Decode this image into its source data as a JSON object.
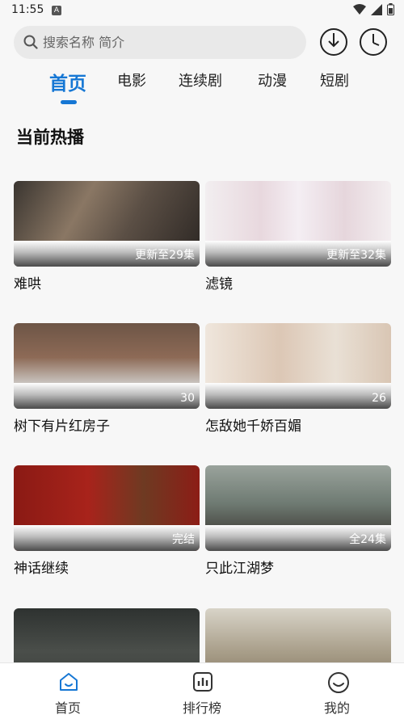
{
  "status_bar": {
    "time": "11:55",
    "notification_letter": "A"
  },
  "search": {
    "placeholder": "搜索名称 简介"
  },
  "tabs": [
    {
      "label": "首页",
      "active": true
    },
    {
      "label": "电影",
      "active": false
    },
    {
      "label": "连续剧",
      "active": false
    },
    {
      "label": "动漫",
      "active": false
    },
    {
      "label": "短剧",
      "active": false
    }
  ],
  "section_title": "当前热播",
  "cards": [
    {
      "title": "难哄",
      "badge": "更新至29集"
    },
    {
      "title": "滤镜",
      "badge": "更新至32集"
    },
    {
      "title": "树下有片红房子",
      "badge": "30"
    },
    {
      "title": "怎敌她千娇百媚",
      "badge": "26"
    },
    {
      "title": "神话继续",
      "badge": "完结"
    },
    {
      "title": "只此江湖梦",
      "badge": "全24集"
    },
    {
      "title": "",
      "badge": ""
    },
    {
      "title": "",
      "badge": ""
    }
  ],
  "bottom_nav": [
    {
      "label": "首页",
      "icon": "home-icon",
      "active": true
    },
    {
      "label": "排行榜",
      "icon": "chart-icon",
      "active": false
    },
    {
      "label": "我的",
      "icon": "profile-icon",
      "active": false
    }
  ],
  "colors": {
    "accent": "#1677d4",
    "background": "#f7f7f7"
  }
}
